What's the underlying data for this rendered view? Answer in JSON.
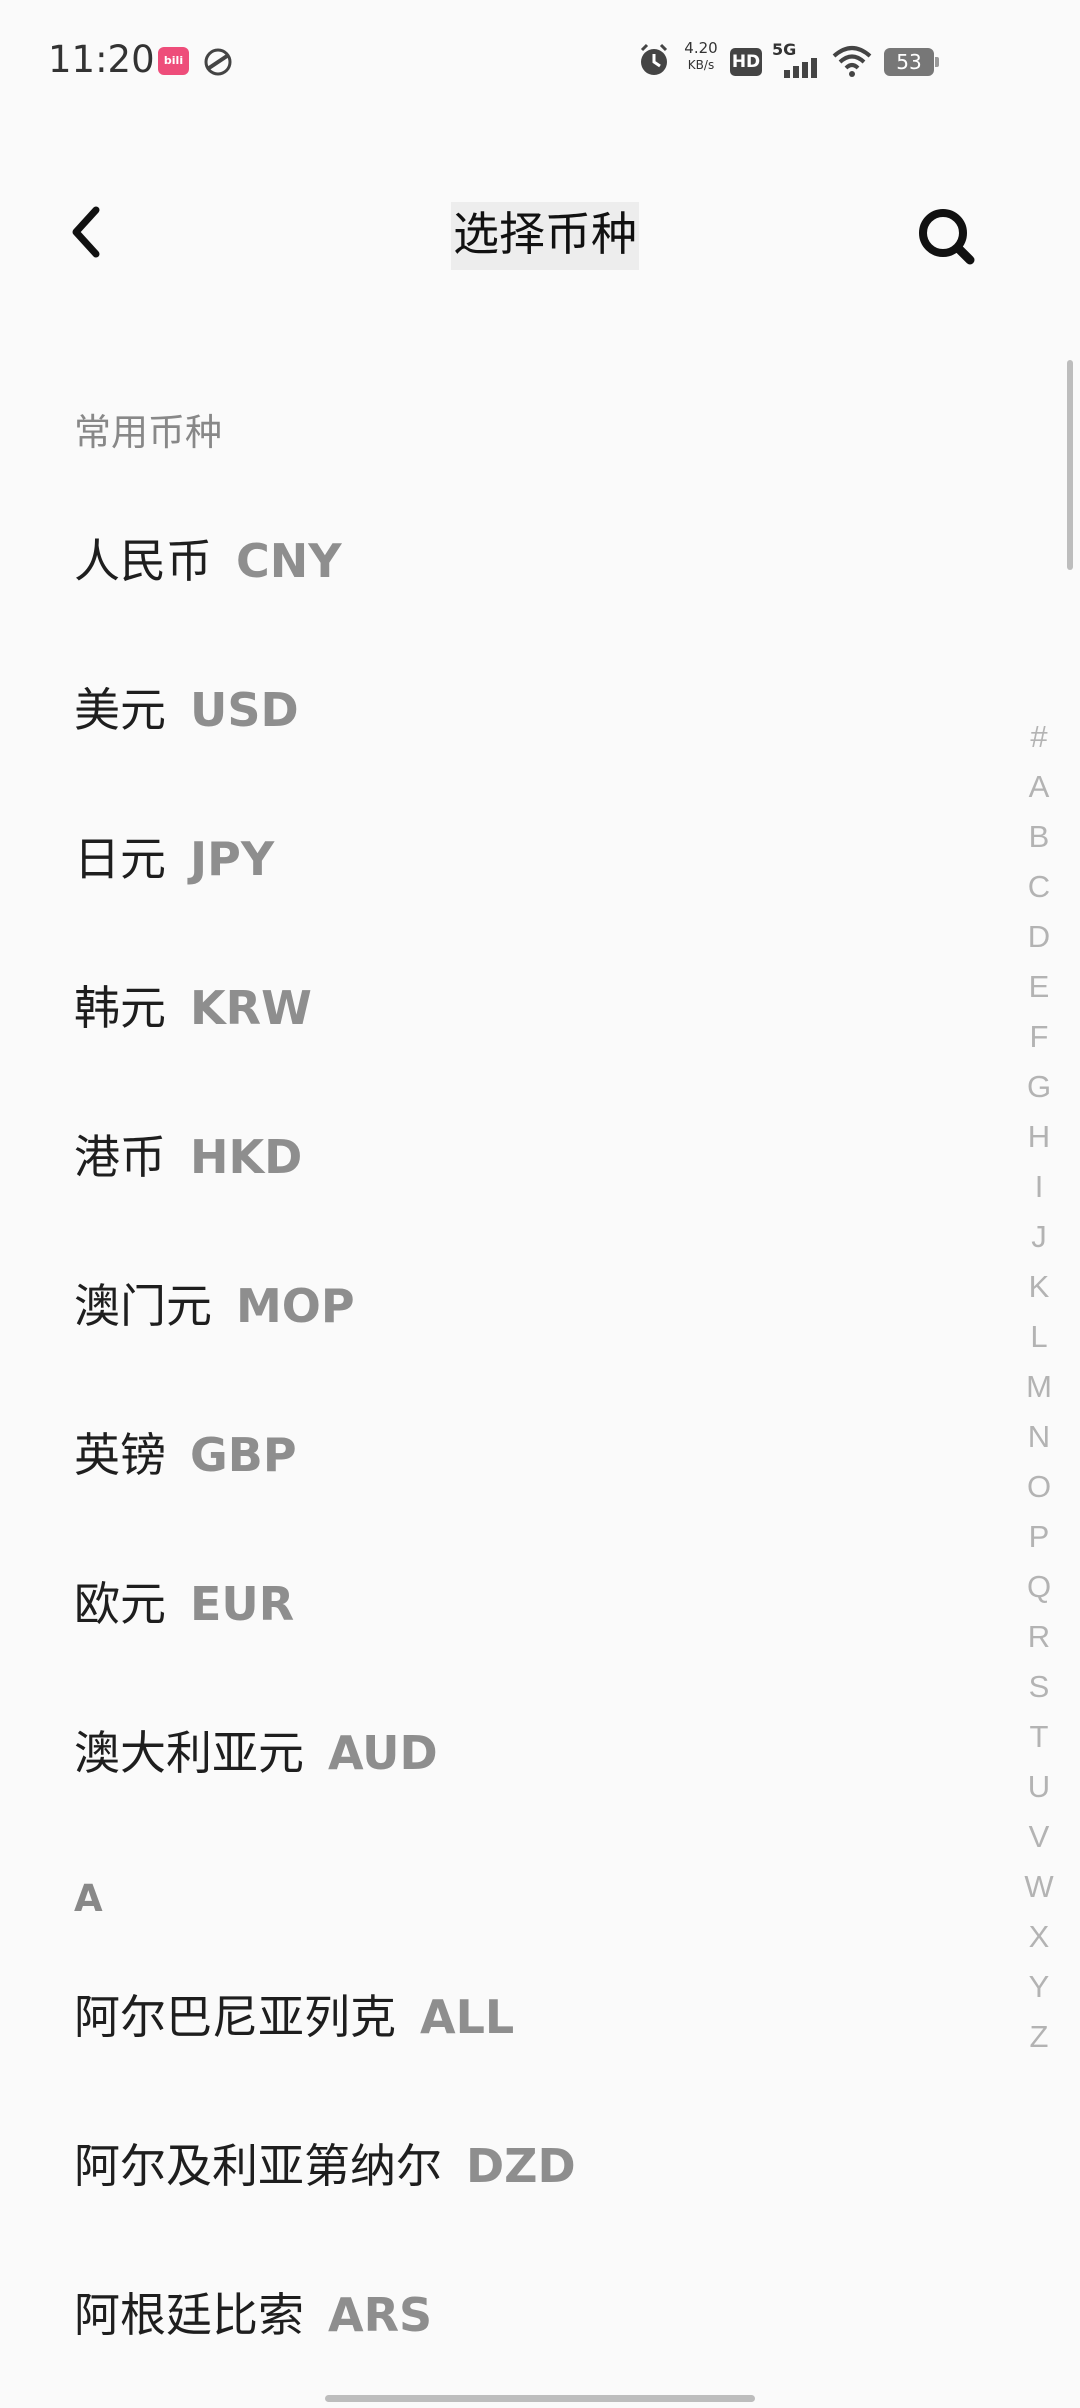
{
  "status_bar": {
    "time": "11:20",
    "network_speed_value": "4.20",
    "network_speed_unit": "KB/s",
    "hd_label": "HD",
    "network_type": "5G",
    "battery": "53",
    "app_icon_label": "bili"
  },
  "header": {
    "title": "选择币种"
  },
  "sections": {
    "common": "常用币种",
    "a": "A"
  },
  "currencies": [
    {
      "name": "人民币",
      "code": "CNY"
    },
    {
      "name": "美元",
      "code": "USD"
    },
    {
      "name": "日元",
      "code": "JPY"
    },
    {
      "name": "韩元",
      "code": "KRW"
    },
    {
      "name": "港币",
      "code": "HKD"
    },
    {
      "name": "澳门元",
      "code": "MOP"
    },
    {
      "name": "英镑",
      "code": "GBP"
    },
    {
      "name": "欧元",
      "code": "EUR"
    },
    {
      "name": "澳大利亚元",
      "code": "AUD"
    },
    {
      "name": "阿尔巴尼亚列克",
      "code": "ALL"
    },
    {
      "name": "阿尔及利亚第纳尔",
      "code": "DZD"
    },
    {
      "name": "阿根廷比索",
      "code": "ARS"
    }
  ],
  "index_letters": [
    "#",
    "A",
    "B",
    "C",
    "D",
    "E",
    "F",
    "G",
    "H",
    "I",
    "J",
    "K",
    "L",
    "M",
    "N",
    "O",
    "P",
    "Q",
    "R",
    "S",
    "T",
    "U",
    "V",
    "W",
    "X",
    "Y",
    "Z"
  ],
  "icons": {
    "back": "chevron-left-icon",
    "search": "search-icon",
    "alarm": "alarm-icon",
    "signal": "signal-icon",
    "wifi": "wifi-icon",
    "battery": "battery-icon"
  }
}
